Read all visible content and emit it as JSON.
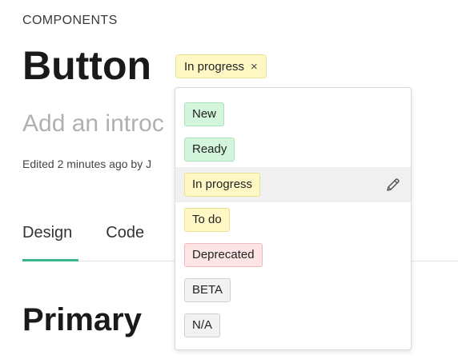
{
  "header": {
    "eyebrow": "COMPONENTS",
    "title": "Button",
    "status_tag": {
      "label": "In progress",
      "remove_glyph": "×"
    },
    "intro_placeholder": "Add an introc",
    "edited": "Edited 2 minutes ago by J"
  },
  "tabs": [
    {
      "label": "Design",
      "active": true
    },
    {
      "label": "Code",
      "active": false
    }
  ],
  "section_title": "Primary",
  "status_menu": {
    "options": [
      {
        "label": "New",
        "bg": "#d3f5dc",
        "border": "#a9e2b7",
        "selected": false
      },
      {
        "label": "Ready",
        "bg": "#d3f5dc",
        "border": "#a9e2b7",
        "selected": false
      },
      {
        "label": "In progress",
        "bg": "#fff8c5",
        "border": "#ebdf93",
        "selected": true
      },
      {
        "label": "To do",
        "bg": "#fff8c5",
        "border": "#ebdf93",
        "selected": false
      },
      {
        "label": "Deprecated",
        "bg": "#fde5e5",
        "border": "#f2b9b9",
        "selected": false
      },
      {
        "label": "BETA",
        "bg": "#f2f2f2",
        "border": "#cfcfcf",
        "selected": false
      },
      {
        "label": "N/A",
        "bg": "#f2f2f2",
        "border": "#cfcfcf",
        "selected": false
      }
    ],
    "edit_icon": "pencil-icon"
  },
  "colors": {
    "accent": "#3bb58a",
    "status_pill_bg": "#fff8c5"
  }
}
